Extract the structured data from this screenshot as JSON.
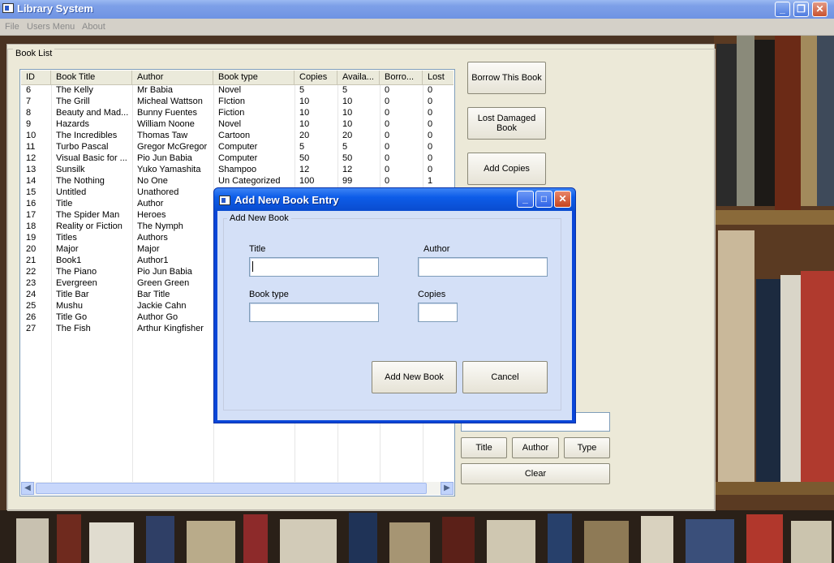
{
  "window": {
    "title": "Library System"
  },
  "menu": {
    "items": [
      "File",
      "Users Menu",
      "About"
    ]
  },
  "book_list": {
    "group_label": "Book List",
    "columns": [
      "ID",
      "Book Title",
      "Author",
      "Book type",
      "Copies",
      "Availa...",
      "Borro...",
      "Lost"
    ],
    "rows": [
      [
        "6",
        "The Kelly",
        "Mr Babia",
        "Novel",
        "5",
        "5",
        "0",
        "0"
      ],
      [
        "7",
        "The Grill",
        "Micheal Wattson",
        "FIction",
        "10",
        "10",
        "0",
        "0"
      ],
      [
        "8",
        "Beauty and Mad...",
        "Bunny Fuentes",
        "Fiction",
        "10",
        "10",
        "0",
        "0"
      ],
      [
        "9",
        "Hazards",
        "William Noone",
        "Novel",
        "10",
        "10",
        "0",
        "0"
      ],
      [
        "10",
        "The Incredibles",
        "Thomas Taw",
        "Cartoon",
        "20",
        "20",
        "0",
        "0"
      ],
      [
        "11",
        "Turbo Pascal",
        "Gregor McGregor",
        "Computer",
        "5",
        "5",
        "0",
        "0"
      ],
      [
        "12",
        "Visual Basic for ...",
        "Pio Jun Babia",
        "Computer",
        "50",
        "50",
        "0",
        "0"
      ],
      [
        "13",
        "Sunsilk",
        "Yuko Yamashita",
        "Shampoo",
        "12",
        "12",
        "0",
        "0"
      ],
      [
        "14",
        "The Nothing",
        "No One",
        "Un Categorized",
        "100",
        "99",
        "0",
        "1"
      ],
      [
        "15",
        "Untitled",
        "Unathored",
        "",
        "",
        "",
        "",
        ""
      ],
      [
        "16",
        "Title",
        "Author",
        "",
        "",
        "",
        "",
        ""
      ],
      [
        "17",
        "The Spider Man",
        "Heroes",
        "",
        "",
        "",
        "",
        ""
      ],
      [
        "18",
        "Reality or Fiction",
        "The Nymph",
        "",
        "",
        "",
        "",
        ""
      ],
      [
        "19",
        "Titles",
        "Authors",
        "",
        "",
        "",
        "",
        ""
      ],
      [
        "20",
        "Major",
        "Major",
        "",
        "",
        "",
        "",
        ""
      ],
      [
        "21",
        "Book1",
        "Author1",
        "",
        "",
        "",
        "",
        ""
      ],
      [
        "22",
        "The Piano",
        "Pio Jun Babia",
        "",
        "",
        "",
        "",
        ""
      ],
      [
        "23",
        "Evergreen",
        "Green Green",
        "",
        "",
        "",
        "",
        ""
      ],
      [
        "24",
        "Title Bar",
        "Bar Title",
        "",
        "",
        "",
        "",
        ""
      ],
      [
        "25",
        "Mushu",
        "Jackie Cahn",
        "",
        "",
        "",
        "",
        ""
      ],
      [
        "26",
        "Title Go",
        "Author Go",
        "",
        "",
        "",
        "",
        ""
      ],
      [
        "27",
        "The Fish",
        "Arthur Kingfisher",
        "",
        "",
        "",
        "",
        ""
      ]
    ]
  },
  "actions": {
    "borrow": "Borrow This Book",
    "lost_damaged": "Lost Damaged Book",
    "add_copies": "Add Copies"
  },
  "search": {
    "value": "",
    "title_btn": "Title",
    "author_btn": "Author",
    "type_btn": "Type",
    "clear_btn": "Clear"
  },
  "dialog": {
    "title": "Add New Book Entry",
    "group_label": "Add New Book",
    "title_label": "Title",
    "author_label": "Author",
    "book_type_label": "Book type",
    "copies_label": "Copies",
    "title_value": "",
    "author_value": "",
    "book_type_value": "",
    "copies_value": "",
    "add_button": "Add New Book",
    "cancel_button": "Cancel"
  },
  "colors": {
    "xp_blue": "#0a46d8",
    "form_bg": "#ece9d8",
    "dialog_bg": "#d4e0f7"
  }
}
